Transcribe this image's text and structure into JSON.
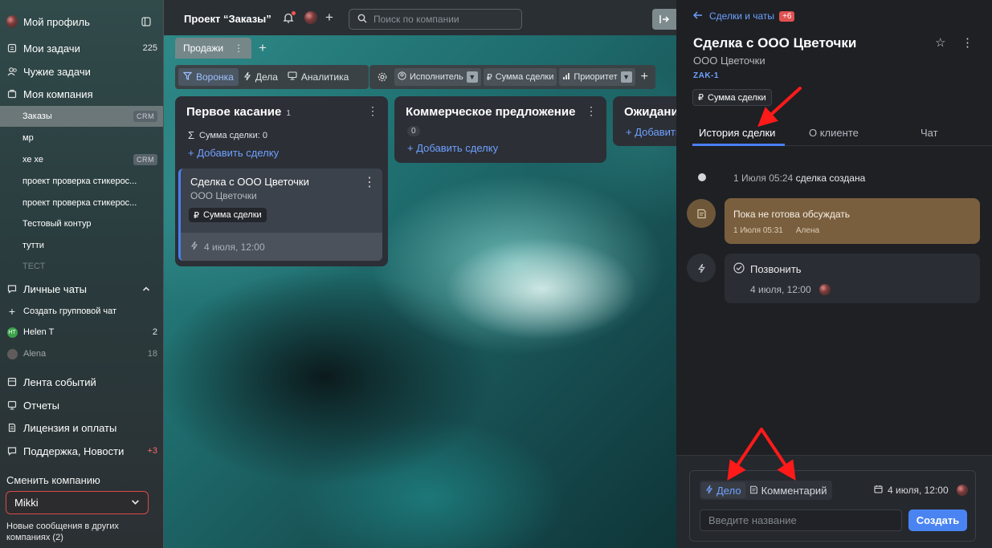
{
  "sidebar": {
    "profile": "Мой профиль",
    "items": [
      {
        "label": "Мои задачи",
        "count": "225"
      },
      {
        "label": "Чужие задачи"
      },
      {
        "label": "Моя компания"
      }
    ],
    "projects": [
      {
        "label": "Заказы",
        "badge": "CRM"
      },
      {
        "label": "мр"
      },
      {
        "label": "хе хе",
        "badge": "CRM"
      },
      {
        "label": "проект проверка стикерос..."
      },
      {
        "label": "проект проверка стикерос..."
      },
      {
        "label": "Тестовый контур"
      },
      {
        "label": "тутти"
      },
      {
        "label": "ТЕСТ"
      }
    ],
    "chats_header": "Личные чаты",
    "create_group": "Создать групповой чат",
    "chats": [
      {
        "name": "Helen T",
        "initials": "HT",
        "count": "2"
      },
      {
        "name": "Alena",
        "count": "18"
      }
    ],
    "bottom": [
      {
        "label": "Лента событий"
      },
      {
        "label": "Отчеты"
      },
      {
        "label": "Лицензия и оплаты"
      },
      {
        "label": "Поддержка, Новости",
        "count": "+3"
      }
    ],
    "switch_label": "Сменить компанию",
    "company": "Mikki",
    "other_messages": "Новые сообщения в других компаниях (2)"
  },
  "topbar": {
    "project_title": "Проект “Заказы”",
    "search_placeholder": "Поиск по компании"
  },
  "board": {
    "tab": "Продажи",
    "views": [
      "Воронка",
      "Дела",
      "Аналитика"
    ],
    "filters": [
      "Исполнитель",
      "Сумма сделки",
      "Приоритет"
    ],
    "columns": [
      {
        "title": "Первое касание",
        "count": "1",
        "sum": "Сумма сделки: 0",
        "add": "+ Добавить сделку"
      },
      {
        "title": "Коммерческое предложение",
        "count": "0",
        "add": "+ Добавить сделку"
      },
      {
        "title": "Ожидани",
        "add": "+ Добавить"
      }
    ],
    "card": {
      "title": "Сделка с ООО Цветочки",
      "company": "ООО Цветочки",
      "tag": "Сумма сделки",
      "date": "4 июля, 12:00"
    }
  },
  "panel": {
    "back": "Сделки и чаты",
    "back_badge": "+6",
    "title": "Сделка с ООО Цветочки",
    "company": "ООО Цветочки",
    "code": "ZAK-1",
    "tag": "Сумма сделки",
    "tabs": [
      "История сделки",
      "О клиенте",
      "Чат"
    ],
    "history": {
      "created_date": "1 Июля 05:24",
      "created_text": "сделка создана",
      "comment_text": "Пока не готова обсуждать",
      "comment_date": "1 Июля 05:31",
      "comment_author": "Алена",
      "task_title": "Позвонить",
      "task_date": "4 июля, 12:00"
    },
    "composer": {
      "mode_task": "Дело",
      "mode_comment": "Комментарий",
      "date": "4 июля, 12:00",
      "placeholder": "Введите название",
      "submit": "Создать"
    }
  },
  "colors": {
    "accent": "#4a84f2",
    "link": "#6fa1ff",
    "annotation": "#ff1a1a",
    "comment": "#7a5f3e"
  }
}
